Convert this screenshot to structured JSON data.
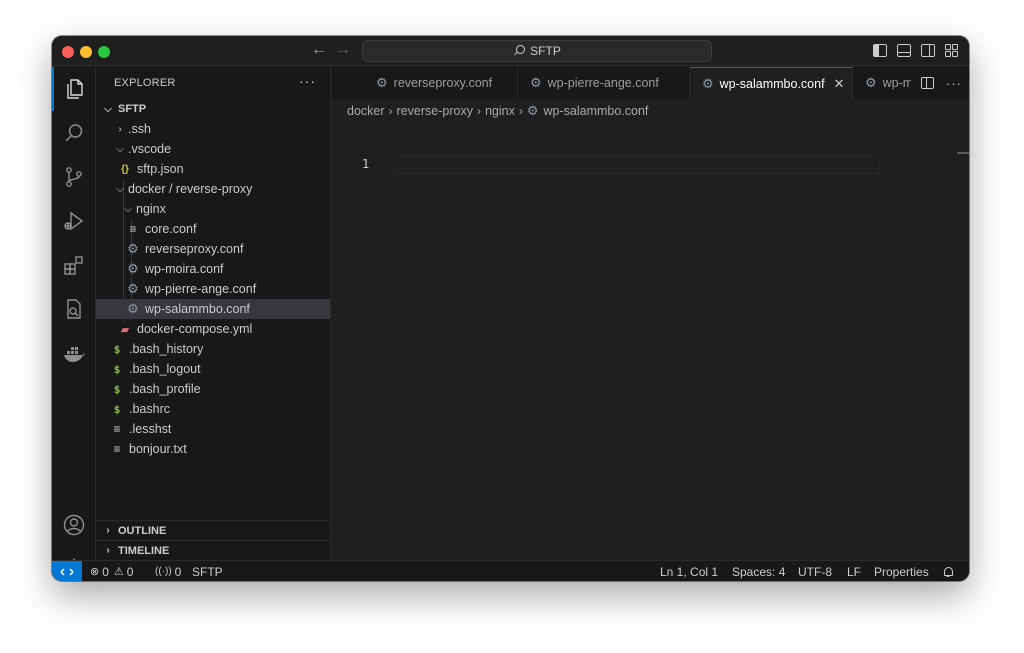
{
  "titlebar": {
    "search_text": "SFTP"
  },
  "activity_bar": {
    "items": [
      "files-icon",
      "search-icon",
      "source-control-icon",
      "run-debug-icon",
      "extensions-icon",
      "remote-explorer-icon",
      "docker-icon"
    ],
    "bottom_items": [
      "account-icon",
      "settings-gear-icon"
    ]
  },
  "explorer": {
    "title": "EXPLORER",
    "more_actions": "···",
    "root": "SFTP",
    "items": [
      {
        "label": ".ssh",
        "type": "folder-collapsed",
        "depth": 1
      },
      {
        "label": ".vscode",
        "type": "folder-expanded",
        "depth": 1
      },
      {
        "label": "sftp.json",
        "type": "json",
        "depth": 2
      },
      {
        "label": "docker / reverse-proxy",
        "type": "folder-expanded",
        "depth": 1
      },
      {
        "label": "nginx",
        "type": "folder-expanded",
        "depth": 2
      },
      {
        "label": "core.conf",
        "type": "text",
        "depth": 3
      },
      {
        "label": "reverseproxy.conf",
        "type": "conf",
        "depth": 3
      },
      {
        "label": "wp-moira.conf",
        "type": "conf",
        "depth": 3
      },
      {
        "label": "wp-pierre-ange.conf",
        "type": "conf",
        "depth": 3
      },
      {
        "label": "wp-salammbo.conf",
        "type": "conf",
        "depth": 3,
        "selected": true
      },
      {
        "label": "docker-compose.yml",
        "type": "docker",
        "depth": 2
      },
      {
        "label": ".bash_history",
        "type": "shell",
        "depth": 1
      },
      {
        "label": ".bash_logout",
        "type": "shell",
        "depth": 1
      },
      {
        "label": ".bash_profile",
        "type": "shell",
        "depth": 1
      },
      {
        "label": ".bashrc",
        "type": "shell",
        "depth": 1
      },
      {
        "label": ".lesshst",
        "type": "text",
        "depth": 1
      },
      {
        "label": "bonjour.txt",
        "type": "text",
        "depth": 1
      }
    ],
    "outline_label": "OUTLINE",
    "timeline_label": "TIMELINE"
  },
  "tabs": [
    {
      "label": "reverseproxy.conf",
      "active": false
    },
    {
      "label": "wp-pierre-ange.conf",
      "active": false
    },
    {
      "label": "wp-salammbo.conf",
      "active": true
    },
    {
      "label": "wp-m",
      "active": false
    }
  ],
  "tab_actions": {
    "more": "···"
  },
  "breadcrumbs": [
    "docker",
    "reverse-proxy",
    "nginx",
    "wp-salammbo.conf"
  ],
  "editor": {
    "line_numbers": [
      "1"
    ]
  },
  "statusbar": {
    "remote": "×",
    "errors": "0",
    "warnings": "0",
    "ports": "0",
    "connection": "SFTP",
    "cursor": "Ln 1, Col 1",
    "spaces": "Spaces: 4",
    "encoding": "UTF-8",
    "eol": "LF",
    "properties": "Properties"
  },
  "colors": {
    "accent": "#0078d4",
    "sidebar_bg": "#181818",
    "editor_bg": "#1f1f1f",
    "selection": "#37373d"
  }
}
